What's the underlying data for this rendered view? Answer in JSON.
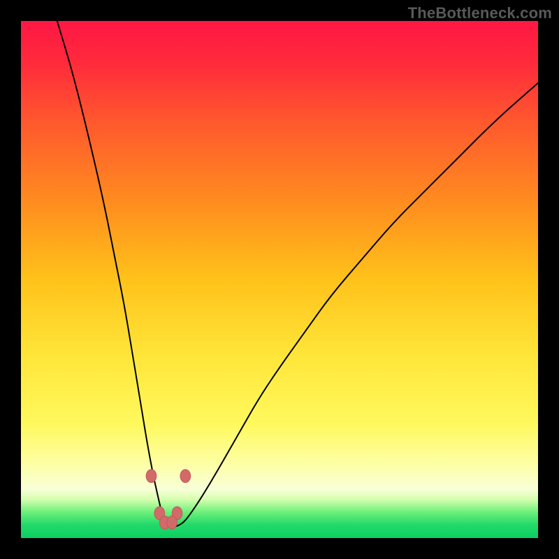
{
  "watermark": "TheBottleneck.com",
  "colors": {
    "frame_background": "#000000",
    "curve_stroke": "#000000",
    "marker_fill": "#d36a6a",
    "marker_stroke": "#c45757",
    "gradient_stops": [
      {
        "offset": 0.0,
        "color": "#ff1744"
      },
      {
        "offset": 0.08,
        "color": "#ff2a3c"
      },
      {
        "offset": 0.2,
        "color": "#ff5a2d"
      },
      {
        "offset": 0.35,
        "color": "#ff8c1f"
      },
      {
        "offset": 0.5,
        "color": "#ffc21a"
      },
      {
        "offset": 0.65,
        "color": "#ffe63a"
      },
      {
        "offset": 0.78,
        "color": "#fff95e"
      },
      {
        "offset": 0.86,
        "color": "#fdffa8"
      },
      {
        "offset": 0.905,
        "color": "#f8ffd8"
      },
      {
        "offset": 0.925,
        "color": "#d6ffb0"
      },
      {
        "offset": 0.95,
        "color": "#6cf07a"
      },
      {
        "offset": 0.975,
        "color": "#22d86a"
      },
      {
        "offset": 1.0,
        "color": "#0ccf62"
      }
    ]
  },
  "chart_data": {
    "type": "line",
    "title": "",
    "xlabel": "",
    "ylabel": "",
    "xlim": [
      0,
      100
    ],
    "ylim": [
      0,
      100
    ],
    "series": [
      {
        "name": "bottleneck-curve",
        "x": [
          7,
          10,
          13,
          16,
          18,
          20,
          21.5,
          23,
          24.3,
          25.5,
          26.5,
          27.2,
          28,
          29,
          30,
          31.5,
          33,
          35,
          38,
          42,
          46,
          50,
          55,
          60,
          66,
          72,
          78,
          85,
          92,
          100
        ],
        "y": [
          100,
          90,
          78,
          65,
          55,
          45,
          36,
          27,
          19,
          12.5,
          8,
          5,
          3,
          2.2,
          2.2,
          3,
          5,
          8,
          13,
          20,
          27,
          33,
          40,
          47,
          54,
          61,
          67,
          74,
          81,
          88
        ]
      }
    ],
    "markers": [
      {
        "x": 25.2,
        "y": 12.0
      },
      {
        "x": 31.8,
        "y": 12.0
      },
      {
        "x": 26.8,
        "y": 4.8
      },
      {
        "x": 30.2,
        "y": 4.8
      },
      {
        "x": 27.8,
        "y": 3.0
      },
      {
        "x": 29.2,
        "y": 3.0
      }
    ],
    "marker_radius": 1.1
  }
}
